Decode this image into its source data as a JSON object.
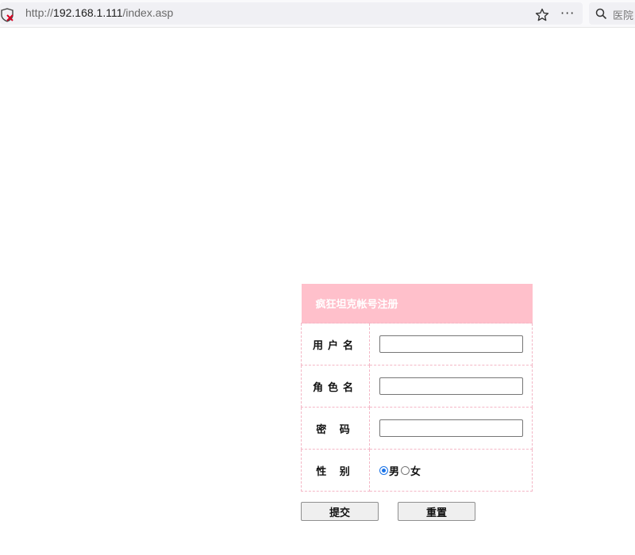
{
  "browser": {
    "url_scheme": "http://",
    "url_host": "192.168.1.111",
    "url_path": "/index.asp",
    "search_placeholder": "医院"
  },
  "form": {
    "title": "疯狂坦克帐号注册",
    "fields": {
      "username_label": "用户名",
      "rolename_label": "角色名",
      "password_label": "密 码",
      "gender_label": "性 别"
    },
    "gender_options": [
      "男",
      "女"
    ],
    "gender_selected": "男",
    "submit_label": "提交",
    "reset_label": "重置"
  },
  "colors": {
    "header_bg": "#ffc0cb",
    "border": "#f4b7c6"
  },
  "icons": [
    "shield-warning-icon",
    "star-icon",
    "more-icon",
    "search-icon"
  ]
}
